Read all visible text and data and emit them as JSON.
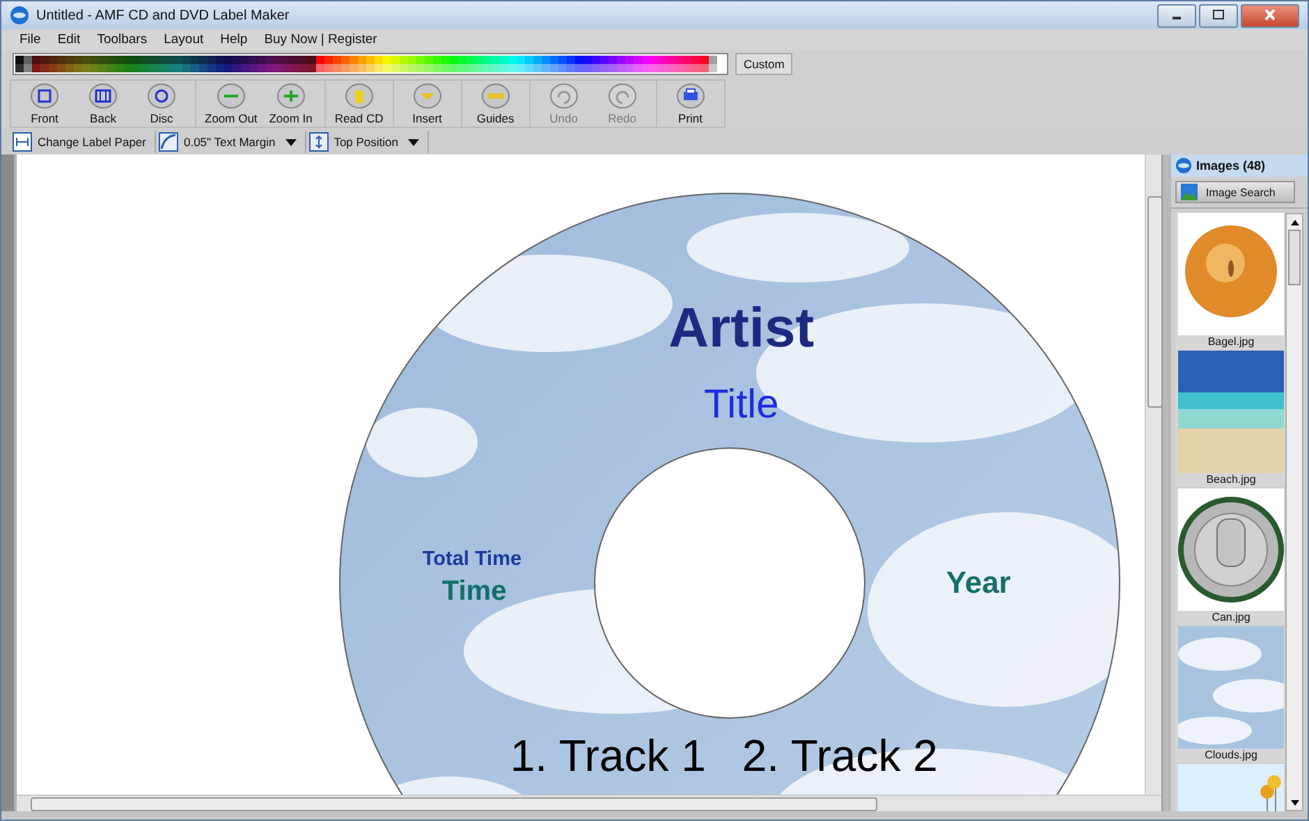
{
  "window": {
    "title": "Untitled - AMF CD and DVD Label Maker"
  },
  "menu": [
    {
      "label": "File"
    },
    {
      "label": "Edit"
    },
    {
      "label": "Toolbars"
    },
    {
      "label": "Layout"
    },
    {
      "label": "Help"
    },
    {
      "label": "Buy Now | Register"
    }
  ],
  "palette": {
    "custom_label": "Custom"
  },
  "toolbar": [
    [
      {
        "label": "Front",
        "disabled": false
      },
      {
        "label": "Back",
        "disabled": false
      },
      {
        "label": "Disc",
        "disabled": false
      }
    ],
    [
      {
        "label": "Zoom Out",
        "disabled": false
      },
      {
        "label": "Zoom In",
        "disabled": false
      }
    ],
    [
      {
        "label": "Read CD",
        "disabled": false
      }
    ],
    [
      {
        "label": "Insert",
        "disabled": false
      }
    ],
    [
      {
        "label": "Guides",
        "disabled": false
      }
    ],
    [
      {
        "label": "Undo",
        "disabled": true
      },
      {
        "label": "Redo",
        "disabled": true
      }
    ],
    [
      {
        "label": "Print",
        "disabled": false
      }
    ]
  ],
  "options_bar": [
    {
      "label": "Change Label Paper",
      "dropdown": false
    },
    {
      "label": "0.05\" Text Margin",
      "dropdown": true
    },
    {
      "label": "Top Position",
      "dropdown": true
    }
  ],
  "label": {
    "artist": "Artist",
    "title": "Title",
    "total_time_label": "Total Time",
    "time": "Time",
    "year": "Year",
    "tracks": [
      "1. Track 1",
      "2. Track 2"
    ]
  },
  "images_panel": {
    "title": "Images (48)",
    "search_button": "Image Search",
    "images": [
      {
        "name": "Bagel.jpg"
      },
      {
        "name": "Beach.jpg"
      },
      {
        "name": "Can.jpg"
      },
      {
        "name": "Clouds.jpg"
      }
    ]
  }
}
